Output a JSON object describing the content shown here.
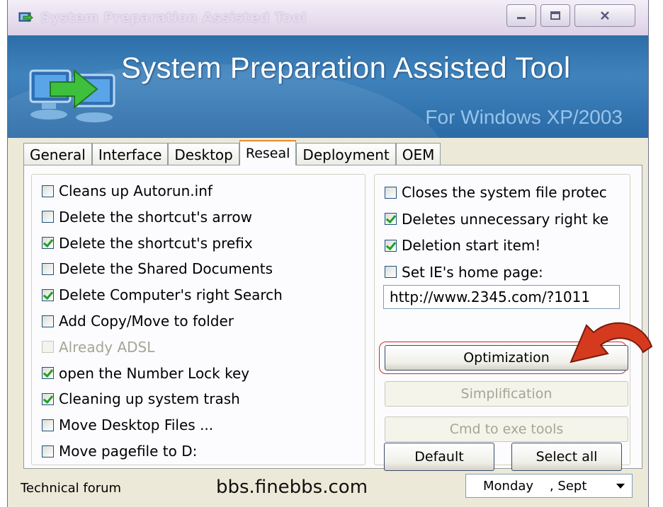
{
  "window": {
    "title": "System Preparation Assisted Tool",
    "colors": {
      "banner": "#3a7bb8",
      "accent_tab": "#e68b2c",
      "highlight_ring": "#d02a2a",
      "check": "#21a121"
    }
  },
  "banner": {
    "title": "System Preparation Assisted Tool",
    "subtitle": "For Windows XP/2003",
    "logo_icon": "computer-arrow-icon"
  },
  "tabs": [
    {
      "label": "General",
      "active": false
    },
    {
      "label": "Interface",
      "active": false
    },
    {
      "label": "Desktop",
      "active": false
    },
    {
      "label": "Reseal",
      "active": true
    },
    {
      "label": "Deployment",
      "active": false
    },
    {
      "label": "OEM",
      "active": false
    }
  ],
  "left_options": [
    {
      "label": "Cleans up Autorun.inf",
      "checked": false,
      "enabled": true
    },
    {
      "label": "Delete the shortcut's arrow",
      "checked": false,
      "enabled": true
    },
    {
      "label": "Delete the shortcut's prefix",
      "checked": true,
      "enabled": true
    },
    {
      "label": "Delete the Shared Documents",
      "checked": false,
      "enabled": true
    },
    {
      "label": "Delete Computer's right Search",
      "checked": true,
      "enabled": true
    },
    {
      "label": "Add Copy/Move to folder",
      "checked": false,
      "enabled": true
    },
    {
      "label": "Already ADSL",
      "checked": false,
      "enabled": false
    },
    {
      "label": "open the Number Lock key",
      "checked": true,
      "enabled": true
    },
    {
      "label": "Cleaning up system trash",
      "checked": true,
      "enabled": true
    },
    {
      "label": "Move Desktop Files ...",
      "checked": false,
      "enabled": true
    },
    {
      "label": "Move pagefile to D:",
      "checked": false,
      "enabled": true
    }
  ],
  "right_options": [
    {
      "label": "Closes the system file protec",
      "checked": false,
      "enabled": true
    },
    {
      "label": "Deletes unnecessary right ke",
      "checked": true,
      "enabled": true
    },
    {
      "label": "Deletion start item!",
      "checked": true,
      "enabled": true
    },
    {
      "label": "Set IE's home page:",
      "checked": false,
      "enabled": true
    }
  ],
  "homepage_url": "http://www.2345.com/?1011",
  "buttons": {
    "optimization": "Optimization",
    "simplification": "Simplification",
    "cmd_to_exe": "Cmd to exe tools",
    "default": "Default",
    "select_all": "Select all"
  },
  "status": {
    "left": "Technical forum",
    "middle": "bbs.finebbs.com",
    "date": "Monday    , Sept"
  }
}
